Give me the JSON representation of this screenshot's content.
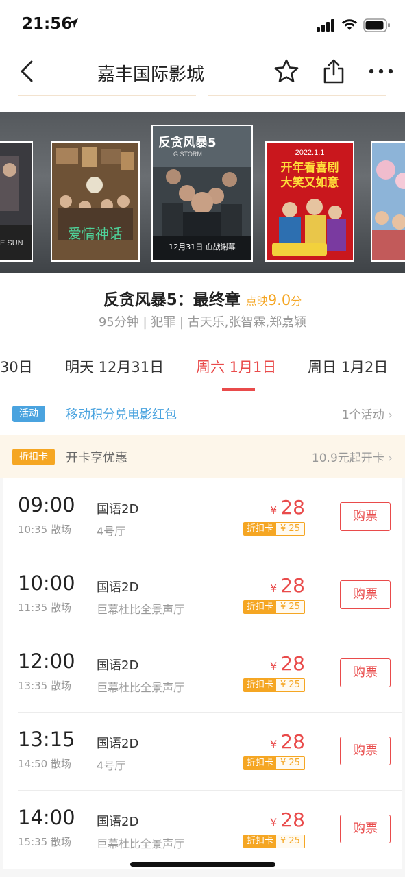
{
  "status_bar": {
    "time": "21:56"
  },
  "nav": {
    "title": "嘉丰国际影城"
  },
  "posters": [
    {
      "name": "poster-left-partial",
      "caption": "E SUN"
    },
    {
      "name": "poster-love-myth",
      "caption": "爱情神话"
    },
    {
      "name": "poster-g-storm",
      "caption": "反贪风暴5",
      "sub": "G STORM",
      "date": "12月31日 血战谢幕"
    },
    {
      "name": "poster-comedy",
      "caption": "开年看喜剧",
      "caption2": "大笑又如意",
      "date": "2022.1.1"
    },
    {
      "name": "poster-right-partial",
      "caption": ""
    }
  ],
  "movie": {
    "name": "反贪风暴5：最终章",
    "score_label": "点映",
    "score": "9.0",
    "score_unit": "分",
    "meta": "95分钟 | 犯罪 | 古天乐,张智霖,郑嘉颖"
  },
  "date_tabs": [
    {
      "label": "30日",
      "active": false
    },
    {
      "label": "明天 12月31日",
      "active": false
    },
    {
      "label": "周六 1月1日",
      "active": true
    },
    {
      "label": "周日 1月2日",
      "active": false
    }
  ],
  "activity": {
    "badge": "活动",
    "text": "移动积分兑电影红包",
    "right": "1个活动"
  },
  "discount": {
    "badge": "折扣卡",
    "text": "开卡享优惠",
    "right": "10.9元起开卡"
  },
  "colors": {
    "accent_red": "#e94b4b",
    "orange": "#f5a623",
    "activity_blue": "#4aa3df"
  },
  "shows": [
    {
      "start": "09:00",
      "end": "10:35 散场",
      "lang": "国语2D",
      "hall": "4号厅",
      "price_symbol": "¥",
      "price": "28",
      "card_label": "折扣卡",
      "card_price": "¥ 25",
      "buy": "购票"
    },
    {
      "start": "10:00",
      "end": "11:35 散场",
      "lang": "国语2D",
      "hall": "巨幕杜比全景声厅",
      "price_symbol": "¥",
      "price": "28",
      "card_label": "折扣卡",
      "card_price": "¥ 25",
      "buy": "购票"
    },
    {
      "start": "12:00",
      "end": "13:35 散场",
      "lang": "国语2D",
      "hall": "巨幕杜比全景声厅",
      "price_symbol": "¥",
      "price": "28",
      "card_label": "折扣卡",
      "card_price": "¥ 25",
      "buy": "购票"
    },
    {
      "start": "13:15",
      "end": "14:50 散场",
      "lang": "国语2D",
      "hall": "4号厅",
      "price_symbol": "¥",
      "price": "28",
      "card_label": "折扣卡",
      "card_price": "¥ 25",
      "buy": "购票"
    },
    {
      "start": "14:00",
      "end": "15:35 散场",
      "lang": "国语2D",
      "hall": "巨幕杜比全景声厅",
      "price_symbol": "¥",
      "price": "28",
      "card_label": "折扣卡",
      "card_price": "¥ 25",
      "buy": "购票"
    }
  ]
}
